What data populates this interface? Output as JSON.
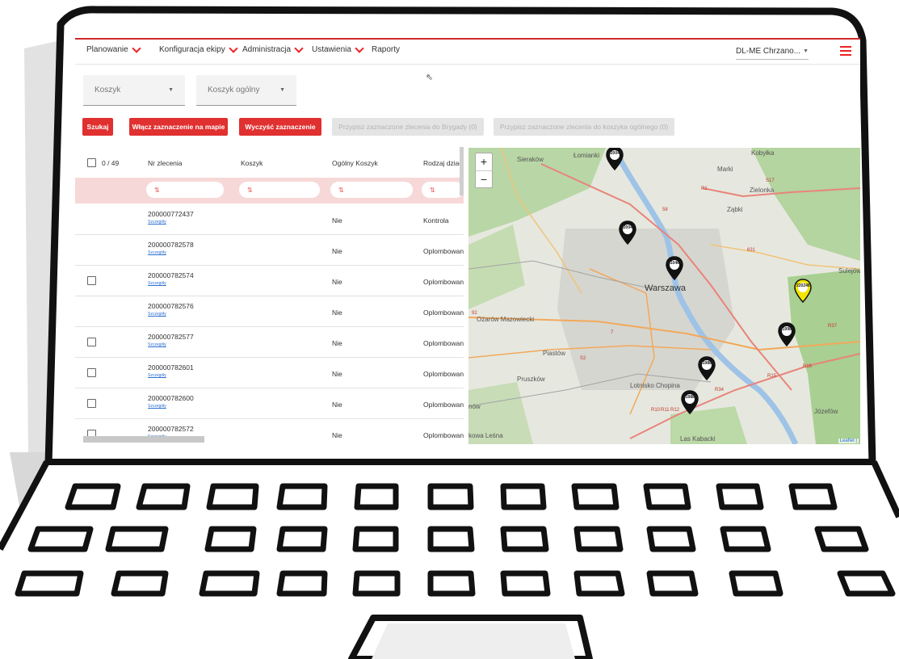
{
  "nav": {
    "items": [
      {
        "label": "Planowanie",
        "dropdown": true
      },
      {
        "label": "Konfiguracja ekipy",
        "dropdown": true
      },
      {
        "label": "Administracja",
        "dropdown": true
      },
      {
        "label": "Ustawienia",
        "dropdown": true
      },
      {
        "label": "Raporty",
        "dropdown": false
      }
    ],
    "user_select": "DL-ME Chrzano..."
  },
  "filters": {
    "koszyk": "Koszyk",
    "koszyk_ogolny": "Koszyk ogólny"
  },
  "buttons": {
    "search": "Szukaj",
    "enable_map_selection": "Włącz zaznaczenie na mapie",
    "clear_selection": "Wyczyść zaznaczenie",
    "assign_brigade": "Przypisz zaznaczone zlecenia do Brygady (0)",
    "assign_general_basket": "Przypisz zaznaczone zlecenia do koszyka ogólnego (0)"
  },
  "table": {
    "selected_count": "0 / 49",
    "columns": [
      "Nr zlecenia",
      "Koszyk",
      "Ogólny Koszyk",
      "Rodzaj działan"
    ],
    "rows": [
      {
        "nr": "200000772437",
        "details": "Szczegóły",
        "ogolny": "Nie",
        "rodzaj": "Kontrola",
        "checkbox": false
      },
      {
        "nr": "200000782578",
        "details": "Szczegóły",
        "ogolny": "Nie",
        "rodzaj": "Oplombowani",
        "checkbox": false
      },
      {
        "nr": "200000782574",
        "details": "Szczegóły",
        "ogolny": "Nie",
        "rodzaj": "Oplombowani",
        "checkbox": true
      },
      {
        "nr": "200000782576",
        "details": "Szczegóły",
        "ogolny": "Nie",
        "rodzaj": "Oplombowani",
        "checkbox": false
      },
      {
        "nr": "200000782577",
        "details": "Szczegóły",
        "ogolny": "Nie",
        "rodzaj": "Oplombowani",
        "checkbox": true
      },
      {
        "nr": "200000782601",
        "details": "Szczegóły",
        "ogolny": "Nie",
        "rodzaj": "Oplombowani",
        "checkbox": true
      },
      {
        "nr": "200000782600",
        "details": "Szczegóły",
        "ogolny": "Nie",
        "rodzaj": "Oplombowani",
        "checkbox": true
      },
      {
        "nr": "200000782572",
        "details": "Szczegóły",
        "ogolny": "Nie",
        "rodzaj": "Oplombowani",
        "checkbox": true
      }
    ]
  },
  "map": {
    "zoom_in": "+",
    "zoom_out": "−",
    "attribution": "Leaflet |",
    "places": [
      "Łomianki",
      "Marki",
      "Kobyłka",
      "Zielonka",
      "Ząbki",
      "Sulejów",
      "Warszawa",
      "Ożarów Mazowiecki",
      "Piastów",
      "Pruszków",
      "Lotnisko Chopina",
      "Józefów",
      "Las Kabacki",
      "kowa Leśna",
      "nów",
      "Sieraków"
    ],
    "road_labels": [
      "58",
      "631",
      "92",
      "7",
      "S2",
      "S17",
      "R16",
      "R15",
      "R34",
      "R10",
      "R11",
      "R12",
      "R37",
      "R1"
    ],
    "markers": [
      {
        "label": "220044",
        "color": "#111111"
      },
      {
        "label": "220047",
        "color": "#111111"
      },
      {
        "label": "210461",
        "color": "#111111"
      },
      {
        "label": "220246",
        "color": "#f2e600"
      },
      {
        "label": "219989",
        "color": "#111111"
      },
      {
        "label": "219888",
        "color": "#111111"
      },
      {
        "label": "219888",
        "color": "#111111"
      }
    ]
  },
  "colors": {
    "accent": "#e03030",
    "filter_row": "#f7d8d8",
    "disabled_button": "#e4e4e4"
  }
}
